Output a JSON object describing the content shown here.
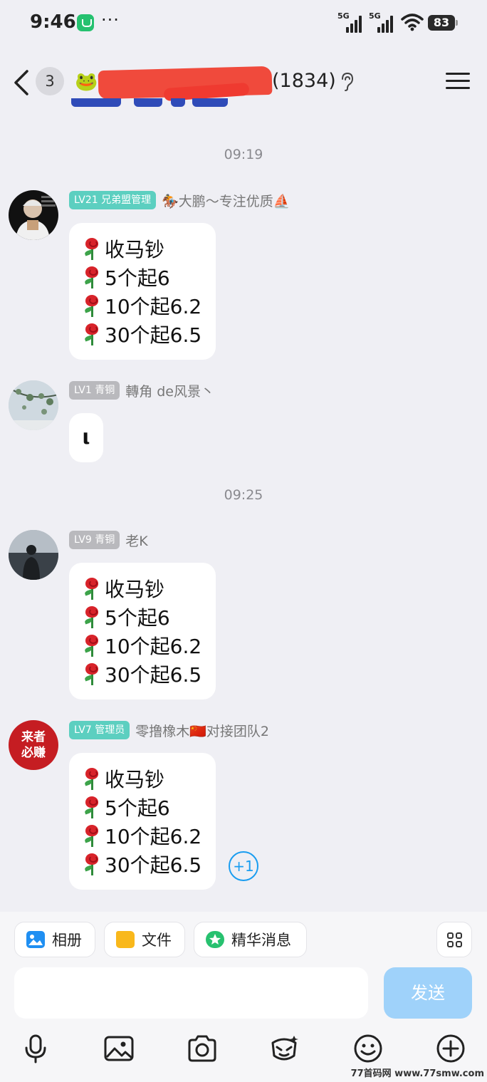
{
  "status_bar": {
    "time": "9:46",
    "dots": "···",
    "network1": "5G",
    "network2": "5G",
    "battery": "83"
  },
  "nav": {
    "unread_count": "3",
    "member_count": "(1834)"
  },
  "messages": [
    {
      "time": "09:19",
      "level": "LV21 兄弟盟管理",
      "sender": "🏇大鹏～专注优质⛵",
      "lines": [
        "收马钞",
        "5个起6",
        "10个起6.2",
        "30个起6.5"
      ]
    },
    {
      "level": "LV1 青铜",
      "sender": "轉角 de风景丶",
      "text": "ι"
    },
    {
      "time": "09:25",
      "level": "LV9 青铜",
      "sender": "老K",
      "lines": [
        "收马钞",
        "5个起6",
        "10个起6.2",
        "30个起6.5"
      ]
    },
    {
      "level": "LV7 管理员",
      "sender": "零撸橡木🇨🇳对接团队2",
      "avatar_text": [
        "来者",
        "必赚"
      ],
      "lines": [
        "收马钞",
        "5个起6",
        "10个起6.2",
        "30个起6.5"
      ],
      "reaction": "+1"
    }
  ],
  "quick_actions": [
    "相册",
    "文件",
    "精华消息"
  ],
  "input": {
    "placeholder": "",
    "send_label": "发送"
  },
  "toolbar_icons": [
    "microphone-icon",
    "image-icon",
    "camera-icon",
    "red-packet-icon",
    "emoji-icon",
    "plus-icon"
  ],
  "watermark": "77首码网 www.77smw.com",
  "colors": {
    "accent": "#1a9df0",
    "badge_admin": "#5ccfc0",
    "badge_member": "#b9b9bd",
    "send_disabled": "#9fd2fa"
  }
}
